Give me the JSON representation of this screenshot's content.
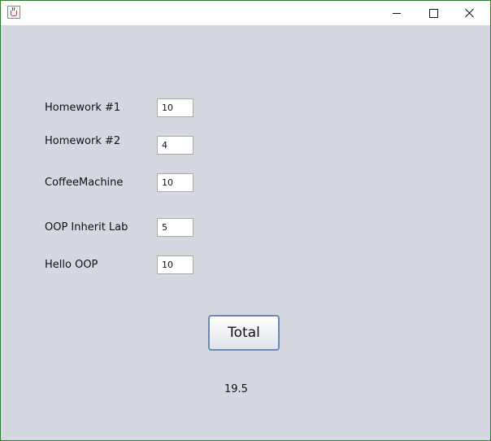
{
  "window": {
    "icon": "java-coffee-cup-icon",
    "controls": {
      "minimize": "minimize-icon",
      "maximize": "maximize-icon",
      "close": "close-icon"
    }
  },
  "form": {
    "rows": [
      {
        "label": "Homework #1",
        "value": "10"
      },
      {
        "label": "Homework #2",
        "value": "4"
      },
      {
        "label": "CoffeeMachine",
        "value": "10"
      },
      {
        "label": "OOP Inherit Lab",
        "value": "5"
      },
      {
        "label": "Hello OOP",
        "value": "10"
      }
    ],
    "total_label": "Total",
    "result": "19.5"
  },
  "colors": {
    "panel_bg": "#d5d8e0",
    "window_border": "#2e7d32",
    "button_border": "#6b89b5"
  }
}
